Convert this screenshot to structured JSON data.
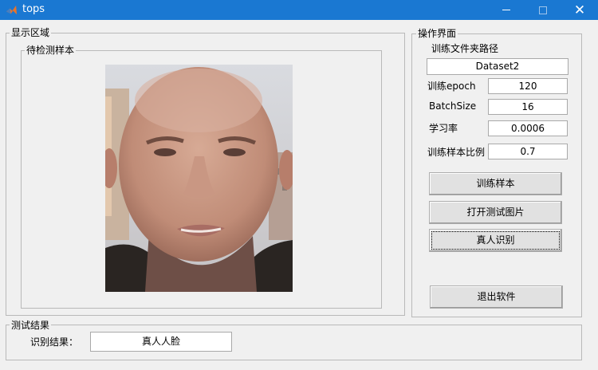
{
  "window": {
    "title": "tops"
  },
  "display_panel": {
    "title": "显示区域",
    "sample_panel_title": "待检测样本"
  },
  "ops_panel": {
    "title": "操作界面",
    "folder_label": "训练文件夹路径",
    "folder_value": "Dataset2",
    "epoch_label": "训练epoch",
    "epoch_value": "120",
    "batch_label": "BatchSize",
    "batch_value": "16",
    "lr_label": "学习率",
    "lr_value": "0.0006",
    "ratio_label": "训练样本比例",
    "ratio_value": "0.7",
    "train_button": "训练样本",
    "open_button": "打开测试图片",
    "recognize_button": "真人识别",
    "exit_button": "退出软件"
  },
  "result_panel": {
    "title": "测试结果",
    "result_label": "识别结果：",
    "result_value": "真人人脸"
  },
  "colors": {
    "titlebar": "#1a78d2",
    "panel_bg": "#f0f0f0"
  }
}
